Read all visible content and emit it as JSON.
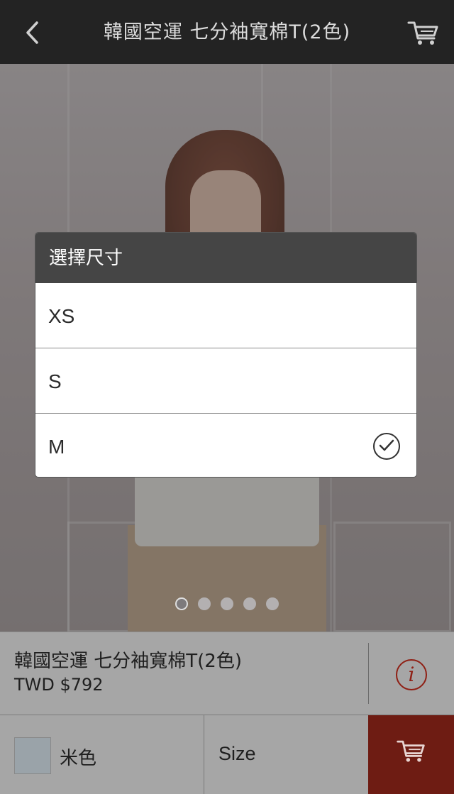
{
  "header": {
    "title": "韓國空運 七分袖寬棉T(2色)",
    "back_icon": "chevron-left-icon",
    "cart_icon": "shopping-cart-icon"
  },
  "gallery": {
    "page_count": 5,
    "active_index": 0
  },
  "product": {
    "name": "韓國空運 七分袖寬棉T(2色)",
    "price": "TWD $792",
    "info_glyph": "i"
  },
  "options": {
    "color_label": "米色",
    "size_label": "Size"
  },
  "size_dialog": {
    "title": "選擇尺寸",
    "options": [
      {
        "label": "XS",
        "selected": false
      },
      {
        "label": "S",
        "selected": false
      },
      {
        "label": "M",
        "selected": true
      }
    ]
  },
  "colors": {
    "header_bg": "#232323",
    "accent": "#6e1c13",
    "info_icon": "#8f1f14",
    "dialog_header": "#454545"
  }
}
